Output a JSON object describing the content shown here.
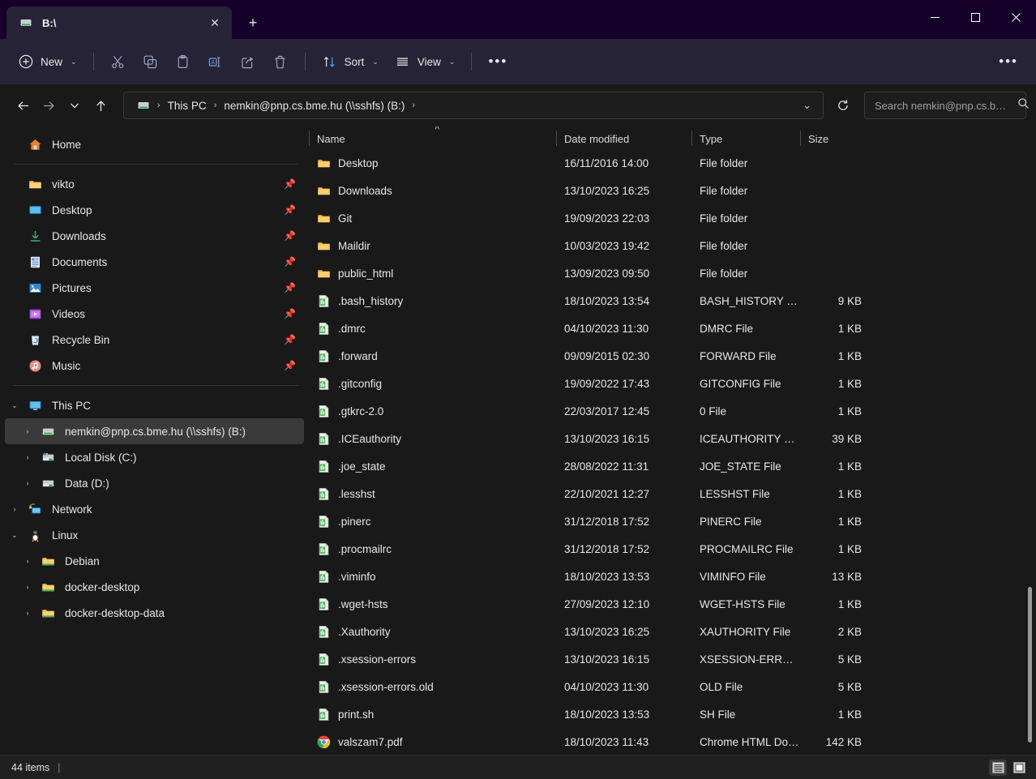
{
  "window": {
    "titlebar_color": "#150029",
    "toolbar_color": "#272336",
    "content_color": "#191919",
    "accent_color": "#4cc2ff",
    "controls": {
      "minimize": "—",
      "maximize": "☐",
      "close": "✕"
    }
  },
  "tabs": [
    {
      "title": "B:\\",
      "icon": "network-drive-icon",
      "close_label": "✕"
    }
  ],
  "newtab_label": "+",
  "toolbar": {
    "new_label": "New",
    "new_icon": "plus-circle-icon",
    "cut_icon": "scissors-icon",
    "copy_icon": "copy-icon",
    "paste_icon": "clipboard-icon",
    "rename_icon": "rename-icon",
    "share_icon": "share-icon",
    "delete_icon": "trash-icon",
    "sort_label": "Sort",
    "sort_icon": "sort-arrows-icon",
    "view_label": "View",
    "view_icon": "view-lines-icon",
    "more_label": "•••",
    "see_more_label": "•••",
    "chevron": "⌄"
  },
  "navigation": {
    "back_icon": "arrow-left-icon",
    "forward_icon": "arrow-right-icon",
    "recent_icon": "chevron-down-icon",
    "up_icon": "arrow-up-icon",
    "refresh_icon": "refresh-icon"
  },
  "breadcrumb": {
    "drive_icon": "network-drive-icon",
    "items": [
      "This PC",
      "nemkin@pnp.cs.bme.hu (\\\\sshfs) (B:)"
    ],
    "separator": "›",
    "trailing_separator": "›",
    "dropdown_chevron": "⌄"
  },
  "search": {
    "placeholder": "Search nemkin@pnp.cs.b…",
    "value": "",
    "icon": "search-icon"
  },
  "sidebar": {
    "home": {
      "label": "Home",
      "icon": "home-icon"
    },
    "quick_access": [
      {
        "label": "vikto",
        "icon": "folder-icon",
        "pinned": true
      },
      {
        "label": "Desktop",
        "icon": "desktop-icon",
        "pinned": true
      },
      {
        "label": "Downloads",
        "icon": "downloads-icon",
        "pinned": true
      },
      {
        "label": "Documents",
        "icon": "documents-icon",
        "pinned": true
      },
      {
        "label": "Pictures",
        "icon": "pictures-icon",
        "pinned": true
      },
      {
        "label": "Videos",
        "icon": "videos-icon",
        "pinned": true
      },
      {
        "label": "Recycle Bin",
        "icon": "recycle-bin-icon",
        "pinned": true
      },
      {
        "label": "Music",
        "icon": "music-icon",
        "pinned": true
      }
    ],
    "tree": [
      {
        "label": "This PC",
        "icon": "this-pc-icon",
        "indent": 0,
        "chevron": "expanded",
        "selected": false
      },
      {
        "label": "nemkin@pnp.cs.bme.hu (\\\\sshfs) (B:)",
        "icon": "network-drive-icon",
        "indent": 1,
        "chevron": "collapsed",
        "selected": true
      },
      {
        "label": "Local Disk (C:)",
        "icon": "local-disk-icon",
        "indent": 1,
        "chevron": "collapsed",
        "selected": false
      },
      {
        "label": "Data (D:)",
        "icon": "drive-icon",
        "indent": 1,
        "chevron": "collapsed",
        "selected": false
      },
      {
        "label": "Network",
        "icon": "network-icon",
        "indent": 0,
        "chevron": "collapsed",
        "selected": false
      },
      {
        "label": "Linux",
        "icon": "linux-penguin-icon",
        "indent": 0,
        "chevron": "expanded",
        "selected": false
      },
      {
        "label": "Debian",
        "icon": "folder-icon",
        "indent": 1,
        "chevron": "collapsed",
        "selected": false
      },
      {
        "label": "docker-desktop",
        "icon": "folder-icon",
        "indent": 1,
        "chevron": "collapsed",
        "selected": false
      },
      {
        "label": "docker-desktop-data",
        "icon": "folder-icon",
        "indent": 1,
        "chevron": "collapsed",
        "selected": false
      }
    ],
    "pin_icon": "pin-icon",
    "chevron_expanded": "⌄",
    "chevron_collapsed": "›"
  },
  "filelist": {
    "columns": [
      "Name",
      "Date modified",
      "Type",
      "Size"
    ],
    "sort_indicator": "˄",
    "sort_column": "Name",
    "sort_direction": "ascending",
    "rows": [
      {
        "name": "Desktop",
        "date": "16/11/2016 14:00",
        "type": "File folder",
        "size": "",
        "icon": "folder-icon"
      },
      {
        "name": "Downloads",
        "date": "13/10/2023 16:25",
        "type": "File folder",
        "size": "",
        "icon": "folder-icon"
      },
      {
        "name": "Git",
        "date": "19/09/2023 22:03",
        "type": "File folder",
        "size": "",
        "icon": "folder-icon"
      },
      {
        "name": "Maildir",
        "date": "10/03/2023 19:42",
        "type": "File folder",
        "size": "",
        "icon": "folder-icon"
      },
      {
        "name": "public_html",
        "date": "13/09/2023 09:50",
        "type": "File folder",
        "size": "",
        "icon": "folder-icon"
      },
      {
        "name": ".bash_history",
        "date": "18/10/2023 13:54",
        "type": "BASH_HISTORY File",
        "size": "9 KB",
        "icon": "generic-file-icon"
      },
      {
        "name": ".dmrc",
        "date": "04/10/2023 11:30",
        "type": "DMRC File",
        "size": "1 KB",
        "icon": "generic-file-icon"
      },
      {
        "name": ".forward",
        "date": "09/09/2015 02:30",
        "type": "FORWARD File",
        "size": "1 KB",
        "icon": "generic-file-icon"
      },
      {
        "name": ".gitconfig",
        "date": "19/09/2022 17:43",
        "type": "GITCONFIG File",
        "size": "1 KB",
        "icon": "generic-file-icon"
      },
      {
        "name": ".gtkrc-2.0",
        "date": "22/03/2017 12:45",
        "type": "0 File",
        "size": "1 KB",
        "icon": "generic-file-icon"
      },
      {
        "name": ".ICEauthority",
        "date": "13/10/2023 16:15",
        "type": "ICEAUTHORITY File",
        "size": "39 KB",
        "icon": "generic-file-icon"
      },
      {
        "name": ".joe_state",
        "date": "28/08/2022 11:31",
        "type": "JOE_STATE File",
        "size": "1 KB",
        "icon": "generic-file-icon"
      },
      {
        "name": ".lesshst",
        "date": "22/10/2021 12:27",
        "type": "LESSHST File",
        "size": "1 KB",
        "icon": "generic-file-icon"
      },
      {
        "name": ".pinerc",
        "date": "31/12/2018 17:52",
        "type": "PINERC File",
        "size": "1 KB",
        "icon": "generic-file-icon"
      },
      {
        "name": ".procmailrc",
        "date": "31/12/2018 17:52",
        "type": "PROCMAILRC File",
        "size": "1 KB",
        "icon": "generic-file-icon"
      },
      {
        "name": ".viminfo",
        "date": "18/10/2023 13:53",
        "type": "VIMINFO File",
        "size": "13 KB",
        "icon": "generic-file-icon"
      },
      {
        "name": ".wget-hsts",
        "date": "27/09/2023 12:10",
        "type": "WGET-HSTS File",
        "size": "1 KB",
        "icon": "generic-file-icon"
      },
      {
        "name": ".Xauthority",
        "date": "13/10/2023 16:25",
        "type": "XAUTHORITY File",
        "size": "2 KB",
        "icon": "generic-file-icon"
      },
      {
        "name": ".xsession-errors",
        "date": "13/10/2023 16:15",
        "type": "XSESSION-ERROR…",
        "size": "5 KB",
        "icon": "generic-file-icon"
      },
      {
        "name": ".xsession-errors.old",
        "date": "04/10/2023 11:30",
        "type": "OLD File",
        "size": "5 KB",
        "icon": "generic-file-icon"
      },
      {
        "name": "print.sh",
        "date": "18/10/2023 13:53",
        "type": "SH File",
        "size": "1 KB",
        "icon": "generic-file-icon"
      },
      {
        "name": "valszam7.pdf",
        "date": "18/10/2023 11:43",
        "type": "Chrome HTML Do…",
        "size": "142 KB",
        "icon": "chrome-icon"
      }
    ]
  },
  "statusbar": {
    "item_count": "44 items",
    "separator": "|",
    "details_view_icon": "details-view-icon",
    "large_icons_view_icon": "large-icons-view-icon"
  }
}
